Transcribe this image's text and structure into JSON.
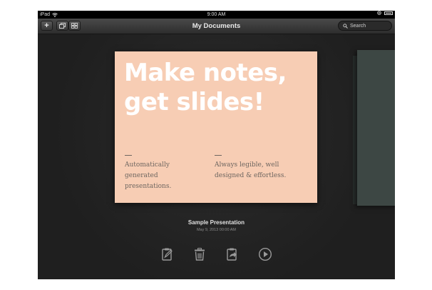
{
  "status": {
    "carrier": "iPad",
    "time": "9:00 AM"
  },
  "navbar": {
    "title": "My Documents",
    "add_label": "+",
    "search_placeholder": "Search"
  },
  "slide": {
    "title": "Make notes, get slides!",
    "left_text": "Automatically generated presentations.",
    "right_text": "Always legible, well designed & effortless."
  },
  "document": {
    "name": "Sample Presentation",
    "date": "May 9, 2013 00:00 AM"
  },
  "icons": {
    "add": "plus-icon",
    "view": "multiple-windows-icon",
    "grid": "grid-icon",
    "search": "search-icon",
    "edit": "edit-note-icon",
    "delete": "trash-icon",
    "share": "share-icon",
    "play": "play-icon"
  },
  "colors": {
    "slide_bg": "#f7cdb4",
    "slide_title": "#ffffff",
    "background": "#232323"
  }
}
